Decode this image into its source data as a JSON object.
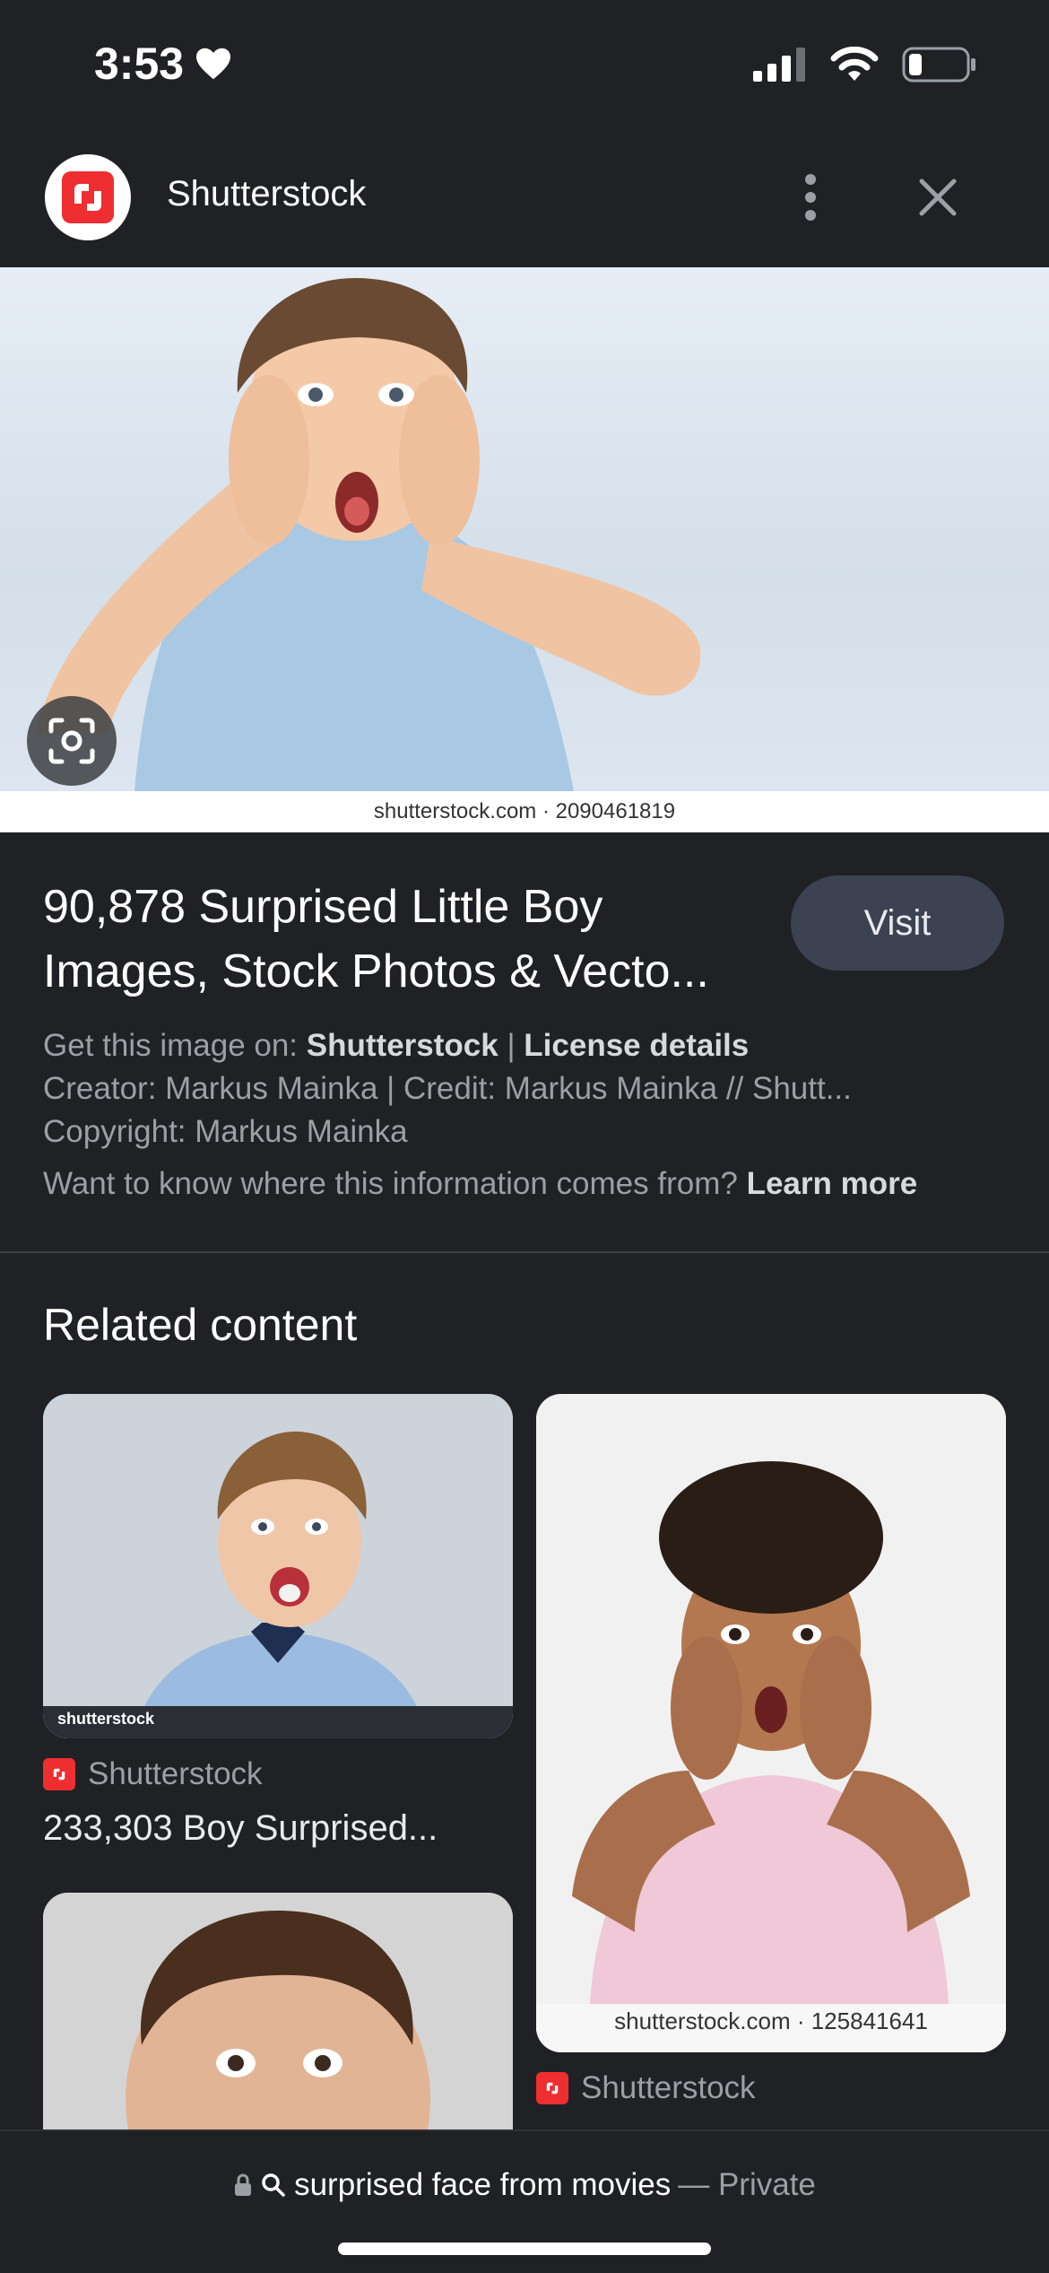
{
  "status_bar": {
    "time": "3:53",
    "heart_icon": "heart-icon",
    "signal_icon": "cellular-signal-icon",
    "wifi_icon": "wifi-icon",
    "battery_icon": "battery-icon"
  },
  "header": {
    "site_name": "Shutterstock",
    "logo_icon": "shutterstock-logo-icon",
    "more_icon": "more-vertical-icon",
    "close_icon": "close-icon"
  },
  "main_image": {
    "caption": "shutterstock.com · 2090461819",
    "lens_icon": "lens-icon"
  },
  "result": {
    "title_line1": "90,878 Surprised Little Boy",
    "title_line2": "Images, Stock Photos & Vecto...",
    "visit_label": "Visit",
    "get_label": "Get this image on:",
    "get_source": "Shutterstock",
    "separator": "|",
    "license_label": "License details",
    "creator_line": "Creator: Markus Mainka | Credit: Markus Mainka // Shutt...",
    "copyright_line": "Copyright: Markus Mainka",
    "info_question": "Want to know where this information comes from?",
    "learn_more": "Learn more"
  },
  "related": {
    "heading": "Related content",
    "cards": [
      {
        "source": "Shutterstock",
        "title": "233,303 Boy Surprised...",
        "watermark": "shutterstock"
      },
      {
        "source": "Shutterstock",
        "caption": "shutterstock.com · 125841641"
      },
      {}
    ]
  },
  "bottom_bar": {
    "lock_icon": "lock-icon",
    "search_icon": "search-icon",
    "query": "surprised face from movies",
    "private_label": "— Private"
  },
  "colors": {
    "background": "#202124",
    "visit_button": "#3c4251",
    "brand_red": "#ee2e31",
    "muted_text": "#9aa0a6"
  }
}
